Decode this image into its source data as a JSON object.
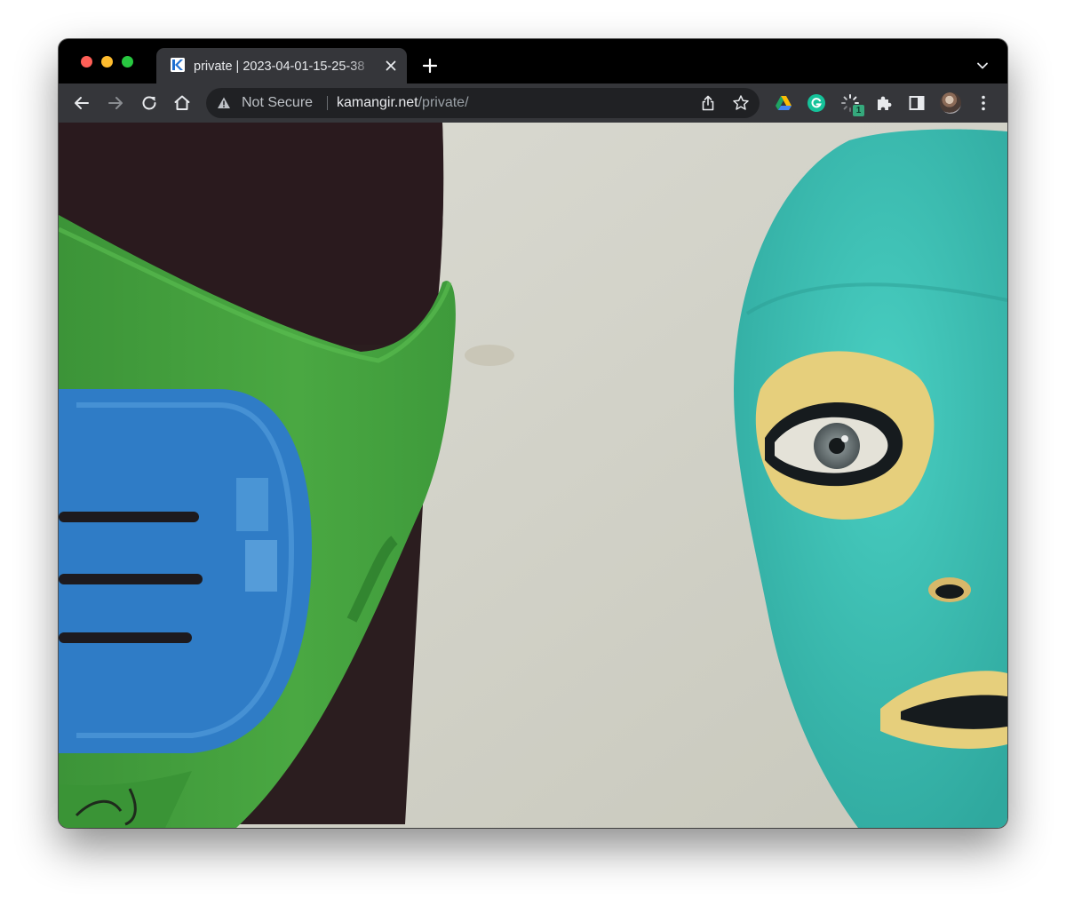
{
  "window": {
    "traffic_lights": [
      "close",
      "minimize",
      "zoom"
    ]
  },
  "tab": {
    "favicon_letter": "K",
    "title": "private | 2023-04-01-15-25-38",
    "close_icon": "close-icon"
  },
  "toolbar": {
    "security_label": "Not Secure",
    "url_domain": "kamangir.net",
    "url_path": "/private/"
  },
  "extensions": {
    "badge_count": "1"
  },
  "colors": {
    "tab_active": "#35363a",
    "tabstrip": "#000000",
    "omnibox": "#202124",
    "mask_green": "#3f9a3a",
    "mask_blue": "#2f7cc6",
    "face_teal": "#3cbfb4",
    "wall": "#cfcfc4"
  }
}
